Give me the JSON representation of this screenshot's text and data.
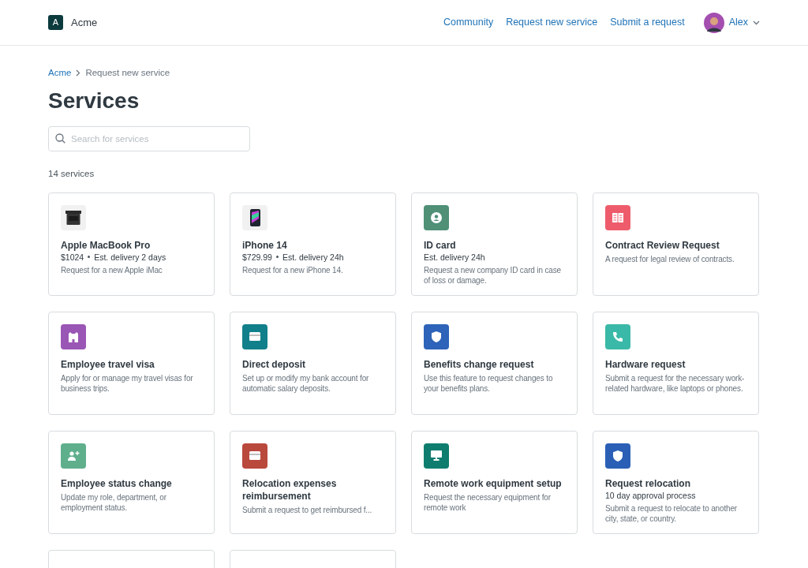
{
  "header": {
    "logo_letter": "A",
    "brand": "Acme",
    "nav": [
      "Community",
      "Request new service",
      "Submit a request"
    ],
    "user": "Alex"
  },
  "breadcrumb": [
    "Acme",
    "Request new service"
  ],
  "title": "Services",
  "search": {
    "placeholder": "Search for services"
  },
  "count": "14 services",
  "services": [
    {
      "kind": "laptop",
      "title": "Apple MacBook Pro",
      "price": "$1024",
      "meta": "Est. delivery 2 days",
      "description": "Request for a new Apple iMac"
    },
    {
      "kind": "phone-photo",
      "title": "iPhone 14",
      "price": "$729.99",
      "meta": "Est. delivery 24h",
      "description": "Request for a new iPhone 14."
    },
    {
      "kind": "person",
      "color": "#4f9077",
      "title": "ID card",
      "meta": "Est. delivery 24h",
      "description": "Request a new company ID card in case of loss or damage."
    },
    {
      "kind": "book",
      "color": "#ee5c6c",
      "title": "Contract Review Request",
      "description": "A request for legal review of contracts."
    },
    {
      "kind": "building",
      "color": "#9a56b5",
      "title": "Employee travel visa",
      "description": "Apply for or manage my travel visas for business trips."
    },
    {
      "kind": "card",
      "color": "#12808a",
      "title": "Direct deposit",
      "description": "Set up or modify my bank account for automatic salary deposits."
    },
    {
      "kind": "shield",
      "color": "#2d63b8",
      "title": "Benefits change request",
      "description": "Use this feature to request changes to your benefits plans."
    },
    {
      "kind": "phone",
      "color": "#3bb9a8",
      "title": "Hardware request",
      "description": "Submit a request for the necessary work-related hardware, like laptops or phones."
    },
    {
      "kind": "person-add",
      "color": "#5faf8c",
      "title": "Employee status change",
      "description": "Update my role, department, or employment status."
    },
    {
      "kind": "card",
      "color": "#b9483d",
      "title": "Relocation expenses reimbursement",
      "description": "Submit a request to get reimbursed f..."
    },
    {
      "kind": "monitor",
      "color": "#0e7d6f",
      "title": "Remote work equipment setup",
      "description": "Request the necessary equipment for remote work"
    },
    {
      "kind": "shield",
      "color": "#2a5fb5",
      "title": "Request relocation",
      "meta": "10 day approval process",
      "description": "Submit a request to relocate to another city, state, or country."
    },
    {
      "kind": "cut"
    },
    {
      "kind": "cut"
    }
  ]
}
